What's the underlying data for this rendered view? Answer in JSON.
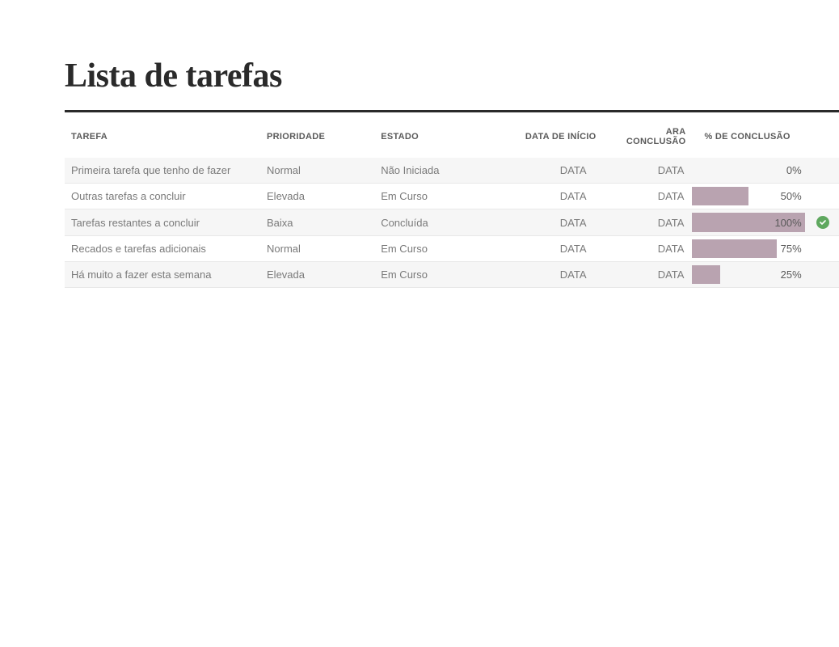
{
  "title": "Lista de tarefas",
  "columns": {
    "task": "TAREFA",
    "priority": "PRIORIDADE",
    "status": "ESTADO",
    "start": "DATA DE INÍCIO",
    "end": "ARA CONCLUSÃO",
    "pct": "% DE CONCLUSÃO"
  },
  "rows": [
    {
      "task": "Primeira tarefa que tenho de fazer",
      "priority": "Normal",
      "status": "Não Iniciada",
      "start": "DATA",
      "end": "DATA",
      "pct_label": "0%",
      "pct_value": 0,
      "done": false,
      "shade": true
    },
    {
      "task": "Outras tarefas a concluir",
      "priority": "Elevada",
      "status": "Em Curso",
      "start": "DATA",
      "end": "DATA",
      "pct_label": "50%",
      "pct_value": 50,
      "done": false,
      "shade": false
    },
    {
      "task": "Tarefas restantes a concluir",
      "priority": "Baixa",
      "status": "Concluída",
      "start": "DATA",
      "end": "DATA",
      "pct_label": "100%",
      "pct_value": 100,
      "done": true,
      "shade": true
    },
    {
      "task": "Recados e tarefas adicionais",
      "priority": "Normal",
      "status": "Em Curso",
      "start": "DATA",
      "end": "DATA",
      "pct_label": "75%",
      "pct_value": 75,
      "done": false,
      "shade": false
    },
    {
      "task": "Há muito a fazer esta semana",
      "priority": "Elevada",
      "status": "Em Curso",
      "start": "DATA",
      "end": "DATA",
      "pct_label": "25%",
      "pct_value": 25,
      "done": false,
      "shade": true
    }
  ],
  "colors": {
    "bar": "#b9a3b0",
    "check": "#5fa85f"
  }
}
